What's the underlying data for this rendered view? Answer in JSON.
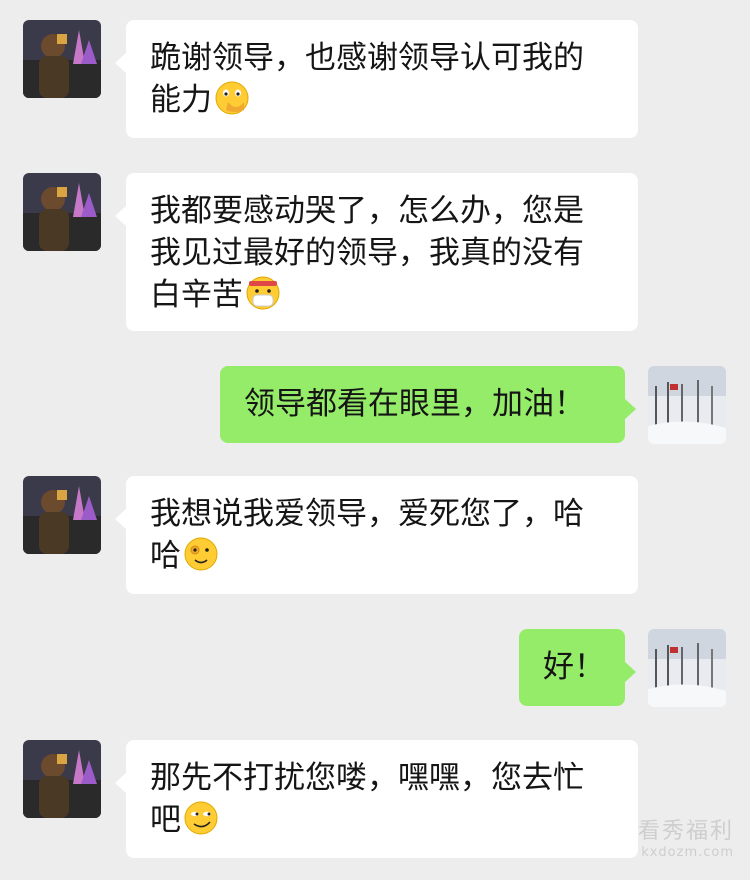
{
  "messages": [
    {
      "side": "in",
      "lines": [
        "跪谢领导，也感谢领导认可我的",
        "能力"
      ],
      "emoji": "face-with-hand-over-mouth-emoji"
    },
    {
      "side": "in",
      "lines": [
        "我都要感动哭了，怎么办，您是",
        "我见过最好的领导，我真的没有",
        "白辛苦"
      ],
      "emoji": "face-with-mask-headband-emoji"
    },
    {
      "side": "out",
      "lines": [
        "领导都看在眼里，加油！"
      ]
    },
    {
      "side": "in",
      "lines": [
        "我想说我爱领导，爱死您了，哈",
        "哈"
      ],
      "emoji": "ok-hand-face-emoji"
    },
    {
      "side": "out",
      "lines": [
        "好！"
      ]
    },
    {
      "side": "in",
      "lines": [
        "那先不打扰您喽，嘿嘿，您去忙",
        "吧"
      ],
      "emoji": "smirk-face-emoji"
    }
  ],
  "watermark": {
    "text_cn": "看秀福利",
    "url": "kxdozm.com"
  },
  "colors": {
    "background": "#ededed",
    "incoming": "#ffffff",
    "outgoing": "#95ec69",
    "text": "#151515"
  }
}
